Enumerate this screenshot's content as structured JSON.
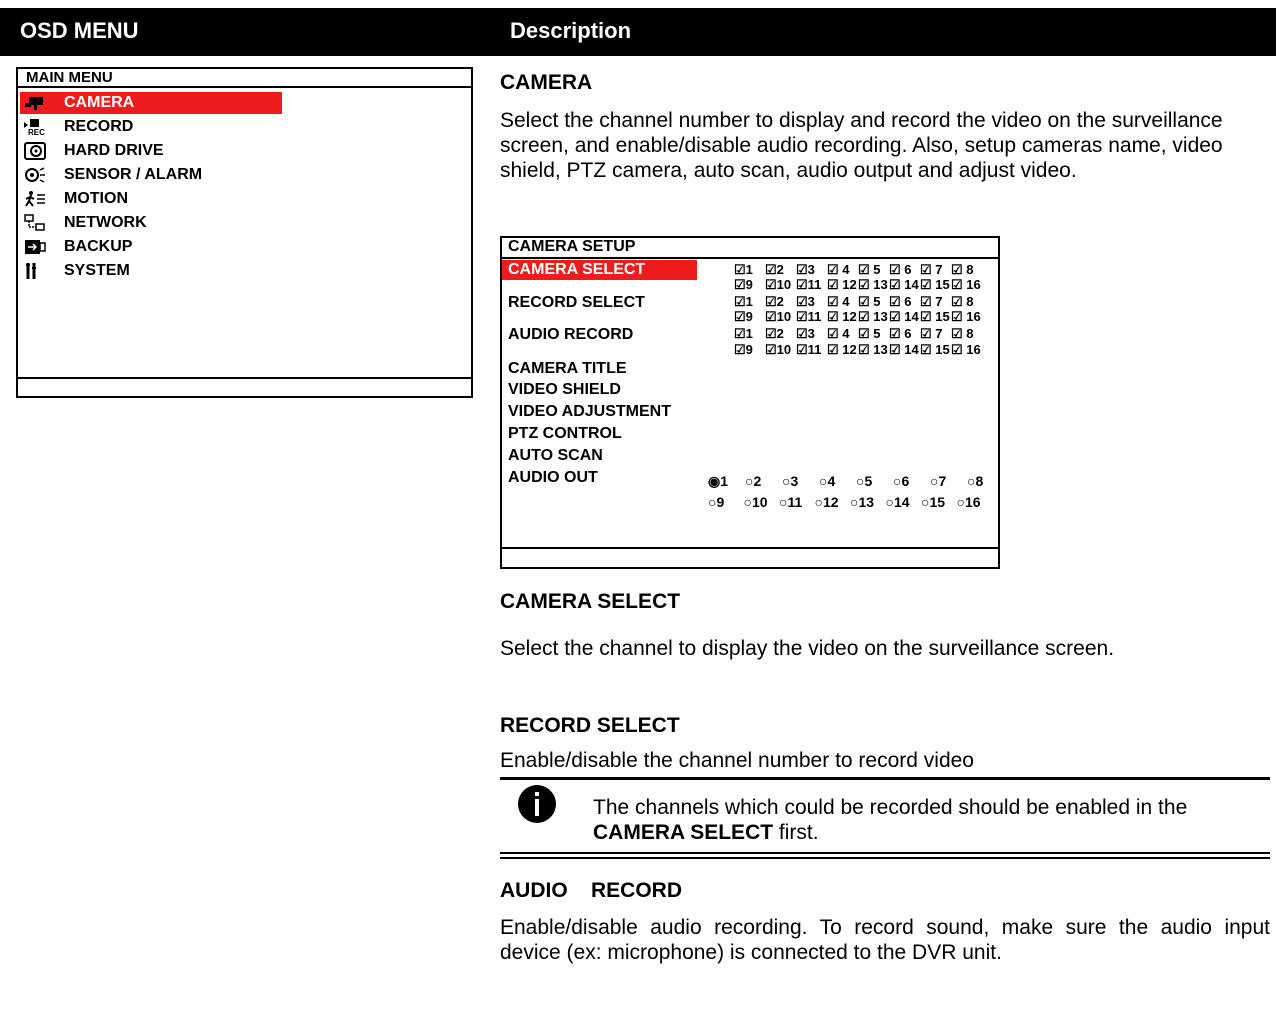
{
  "header": {
    "col1": "OSD MENU",
    "col2": "Description"
  },
  "main_menu": {
    "title": "MAIN  MENU",
    "items": [
      {
        "label": "CAMERA",
        "icon": "camera-icon",
        "selected": true
      },
      {
        "label": "RECORD",
        "icon": "record-icon"
      },
      {
        "label": "HARD DRIVE",
        "icon": "hard-drive-icon"
      },
      {
        "label": "SENSOR / ALARM",
        "icon": "alarm-icon"
      },
      {
        "label": "MOTION",
        "icon": "motion-icon"
      },
      {
        "label": "NETWORK",
        "icon": "network-icon"
      },
      {
        "label": "BACKUP",
        "icon": "backup-icon"
      },
      {
        "label": "SYSTEM",
        "icon": "system-icon"
      }
    ]
  },
  "camera": {
    "heading": "CAMERA",
    "description": "Select the channel number to display and record the video on the surveillance screen, and enable/disable audio recording. Also, setup cameras name, video shield, PTZ camera, auto scan, audio output and adjust video."
  },
  "camera_setup": {
    "title": "CAMERA SETUP",
    "labels": {
      "camera_select": "CAMERA SELECT",
      "record_select": "RECORD SELECT",
      "audio_record": "AUDIO RECORD",
      "camera_title": "CAMERA TITLE",
      "video_shield": "VIDEO SHIELD",
      "video_adjustment": "VIDEO ADJUSTMENT",
      "ptz_control": "PTZ CONTROL",
      "auto_scan": "AUTO SCAN",
      "audio_out": "AUDIO OUT"
    },
    "check_row1": [
      "☑1",
      "☑2",
      "☑3",
      "☑ 4",
      "☑ 5",
      "☑ 6",
      "☑ 7",
      "☑ 8"
    ],
    "check_row2": [
      "☑9",
      "☑10",
      "☑11",
      "☑ 12",
      "☑ 13",
      "☑ 14",
      "☑ 15",
      "☑ 16"
    ],
    "radio_row1": [
      "◉1",
      "○2",
      "○3",
      "○4",
      "○5",
      "○6",
      "○7",
      "○8"
    ],
    "radio_row2": [
      "○9",
      "○10",
      "○11",
      "○12",
      "○13",
      "○14",
      "○15",
      "○16"
    ]
  },
  "camera_select": {
    "heading": "CAMERA SELECT",
    "description": "Select the channel to display the video on the surveillance screen."
  },
  "record_select": {
    "heading": "RECORD SELECT",
    "description": "Enable/disable the channel number to record video",
    "note_pre": "The channels which could be recorded should be enabled in the ",
    "note_bold": "CAMERA SELECT",
    "note_post": " first."
  },
  "audio_record": {
    "heading": "AUDIO    RECORD",
    "description": "Enable/disable audio recording. To record sound, make sure the audio input device (ex: microphone) is connected to the DVR unit."
  }
}
